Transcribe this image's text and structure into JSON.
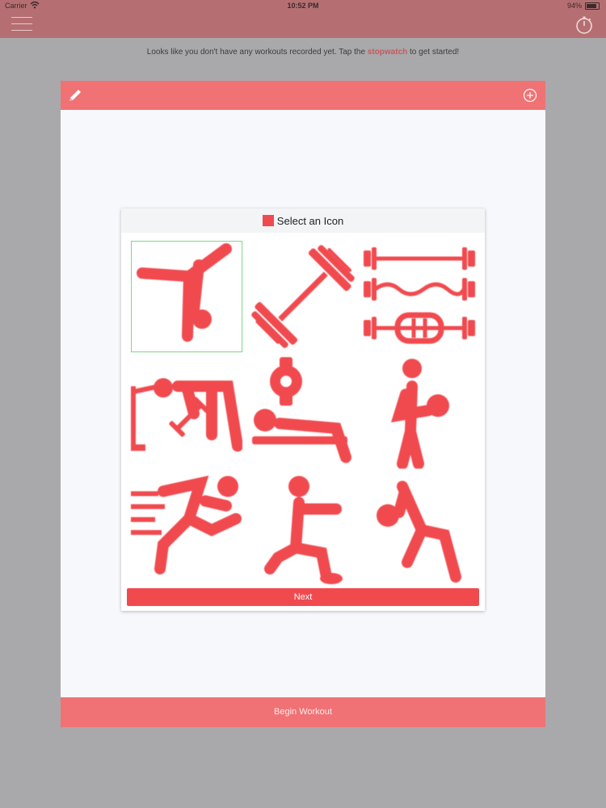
{
  "status_bar": {
    "carrier": "Carrier",
    "time": "10:52 PM",
    "battery": "94%"
  },
  "nav": {
    "menu_icon": "hamburger-menu-icon",
    "stopwatch_icon": "stopwatch-icon"
  },
  "message": {
    "prefix": "Looks like you don't have any workouts recorded yet. Tap the ",
    "link": "stopwatch",
    "suffix": " to get started!"
  },
  "card": {
    "edit_icon": "pencil-icon",
    "add_icon": "plus-circle-icon",
    "begin_label": "Begin Workout"
  },
  "icon_picker": {
    "title": "Select an Icon",
    "next_label": "Next",
    "selected_index": 0,
    "icons": [
      "handstand-kick-icon",
      "dumbbell-icon",
      "barbells-icon",
      "cable-row-icon",
      "bench-press-icon",
      "medicine-ball-icon",
      "sprinter-icon",
      "lunge-icon",
      "ball-stretch-icon"
    ]
  },
  "colors": {
    "accent": "#f04a4f",
    "header": "#f07275",
    "nav_bar": "#b56f72",
    "selection": "#7dd88a"
  }
}
